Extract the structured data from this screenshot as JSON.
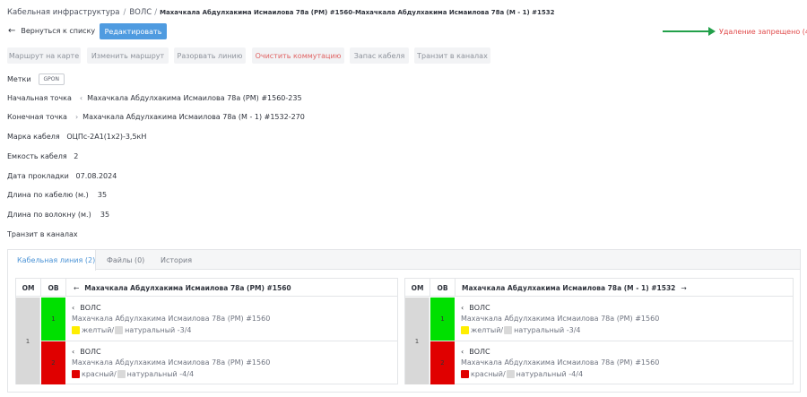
{
  "breadcrumb": {
    "root": "Кабельная инфраструктура",
    "section": "ВОЛС",
    "current": "Махачкала Абдулхакима Исмаилова 78а (РМ) #1560-Махачкала Абдулхакима Исмаилова 78а (М - 1) #1532"
  },
  "header": {
    "back_label": "Вернуться к списку",
    "edit_label": "Редактировать",
    "deny_label": "Удаление запрещено (4)"
  },
  "toolbar": {
    "buttons": [
      {
        "label": "Маршрут на карте"
      },
      {
        "label": "Изменить маршрут"
      },
      {
        "label": "Разорвать линию"
      },
      {
        "label": "Очистить коммутацию"
      },
      {
        "label": "Запас кабеля"
      },
      {
        "label": "Транзит в каналах"
      }
    ]
  },
  "details": {
    "tags_label": "Метки",
    "tag": "GPON",
    "start_label": "Начальная точка",
    "start_value": "Махачкала Абдулхакима Исмаилова 78а (РМ) #1560-235",
    "end_label": "Конечная точка",
    "end_value": "Махачкала Абдулхакима Исмаилова 78а (М - 1) #1532-270",
    "brand_label": "Марка кабеля",
    "brand_value": "ОЦПс-2А1(1х2)-3,5кН",
    "capacity_label": "Емкость кабеля",
    "capacity_value": "2",
    "date_label": "Дата прокладки",
    "date_value": "07.08.2024",
    "len_cable_label": "Длина по кабелю (м.)",
    "len_cable_value": "35",
    "len_fiber_label": "Длина по волокну (м.)",
    "len_fiber_value": "35",
    "transit_label": "Транзит в каналах"
  },
  "tabs": [
    {
      "label": "Кабельная линия (2)"
    },
    {
      "label": "Файлы (0)"
    },
    {
      "label": "История"
    }
  ],
  "colors": {
    "accent": "#4f9be0",
    "danger": "#e04a4a",
    "green": "#00e000",
    "red": "#e00000",
    "yellow": "#ffee00",
    "natural": "#d9d9d9"
  },
  "left_table": {
    "om_header": "ОМ",
    "ov_header": "ОВ",
    "title": "Махачкала Абдулхакима Исмаилова 78а (РМ) #1560",
    "om_value": "1",
    "rows": [
      {
        "ov": "1",
        "type": "ВОЛС",
        "node": "Махачкала Абдулхакима Исмаилова 78а (РМ) #1560",
        "color1": "желтый/",
        "color2": "натуральный -3/4"
      },
      {
        "ov": "2",
        "type": "ВОЛС",
        "node": "Махачкала Абдулхакима Исмаилова 78а (РМ) #1560",
        "color1": "красный/",
        "color2": "натуральный -4/4"
      }
    ]
  },
  "right_table": {
    "om_header": "ОМ",
    "ov_header": "ОВ",
    "title": "Махачкала Абдулхакима Исмаилова 78а (М - 1) #1532",
    "om_value": "1",
    "rows": [
      {
        "ov": "1",
        "type": "ВОЛС",
        "node": "Махачкала Абдулхакима Исмаилова 78а (РМ) #1560",
        "color1": "желтый/",
        "color2": "натуральный -3/4"
      },
      {
        "ov": "2",
        "type": "ВОЛС",
        "node": "Махачкала Абдулхакима Исмаилова 78а (РМ) #1560",
        "color1": "красный/",
        "color2": "натуральный -4/4"
      }
    ]
  }
}
